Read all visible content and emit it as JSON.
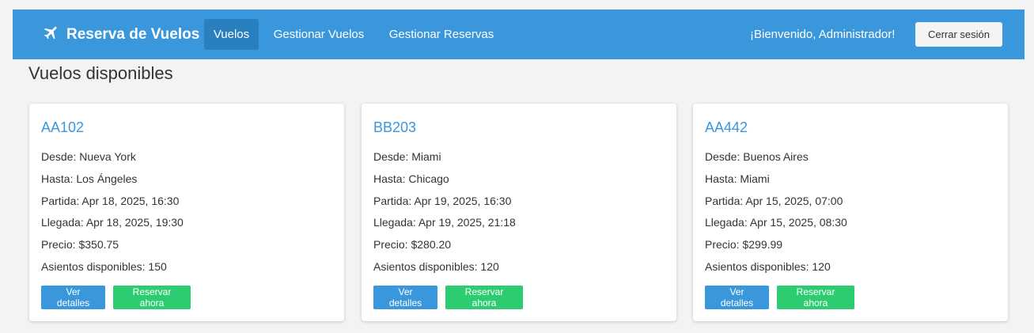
{
  "navbar": {
    "brand": "Reserva de Vuelos",
    "links": [
      "Vuelos",
      "Gestionar Vuelos",
      "Gestionar Reservas"
    ],
    "welcome": "¡Bienvenido, Administrador!",
    "logout": "Cerrar sesión"
  },
  "heading": "Vuelos disponibles",
  "flights": [
    {
      "code": "AA102",
      "from": "Desde: Nueva York",
      "to": "Hasta: Los Ángeles",
      "departure": "Partida: Apr 18, 2025, 16:30",
      "arrival": "Llegada: Apr 18, 2025, 19:30",
      "price": "Precio: $350.75",
      "seats": "Asientos disponibles: 150",
      "details_label": "Ver detalles",
      "reserve_label": "Reservar ahora"
    },
    {
      "code": "BB203",
      "from": "Desde: Miami",
      "to": "Hasta: Chicago",
      "departure": "Partida: Apr 19, 2025, 16:30",
      "arrival": "Llegada: Apr 19, 2025, 21:18",
      "price": "Precio: $280.20",
      "seats": "Asientos disponibles: 120",
      "details_label": "Ver detalles",
      "reserve_label": "Reservar ahora"
    },
    {
      "code": "AA442",
      "from": "Desde: Buenos Aires",
      "to": "Hasta: Miami",
      "departure": "Partida: Apr 15, 2025, 07:00",
      "arrival": "Llegada: Apr 15, 2025, 08:30",
      "price": "Precio: $299.99",
      "seats": "Asientos disponibles: 120",
      "details_label": "Ver detalles",
      "reserve_label": "Reservar ahora"
    }
  ],
  "colors": {
    "navbar": "#3a97dc",
    "nav_active": "#2a7fbf",
    "primary_button": "#3a97dc",
    "success_button": "#2ecc71"
  },
  "icons": {
    "brand": "airplane-icon"
  }
}
